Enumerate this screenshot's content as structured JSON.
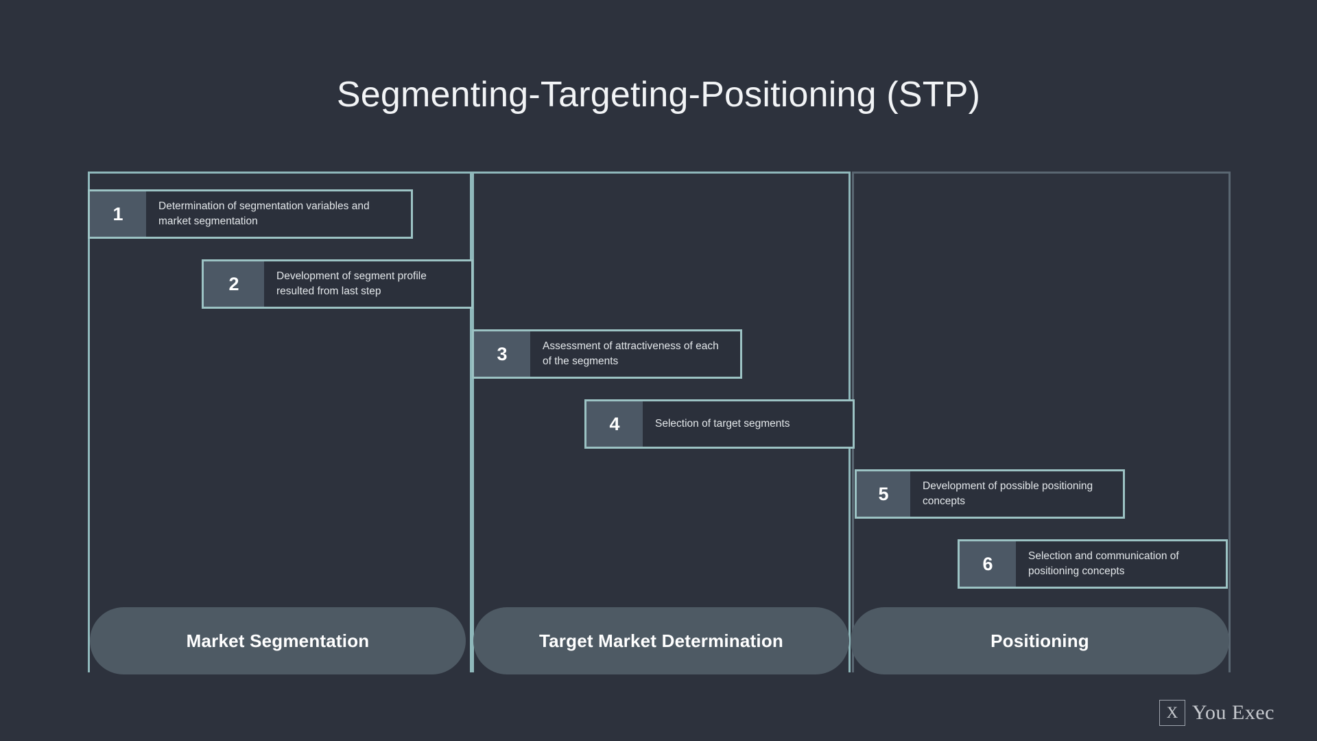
{
  "slide": {
    "title": "Segmenting-Targeting-Positioning (STP)",
    "background_color": "#2d323d"
  },
  "colors": {
    "background": "#2d323d",
    "step_border": "#9cc3c4",
    "step_number_bg": "#4c5865",
    "step_body_bg": "#2b303b",
    "column_border_active": "#8fb8bb",
    "column_border_muted": "#5a6772",
    "pill_bg": "#4e5a64",
    "text_primary": "#ffffff",
    "text_secondary": "#e3e7ea"
  },
  "columns": [
    {
      "id": "market-segmentation",
      "label": "Market Segmentation",
      "border_color": "#8fb8bb"
    },
    {
      "id": "target-market-determination",
      "label": "Target Market Determination",
      "border_color": "#8fb8bb"
    },
    {
      "id": "positioning",
      "label": "Positioning",
      "border_color": "#5a6772"
    }
  ],
  "steps": [
    {
      "number": "1",
      "text": "Determination of segmentation variables and market segmentation",
      "column": "market-segmentation"
    },
    {
      "number": "2",
      "text": "Development of segment profile resulted from last step",
      "column": "market-segmentation"
    },
    {
      "number": "3",
      "text": "Assessment of attractiveness of each of the segments",
      "column": "target-market-determination"
    },
    {
      "number": "4",
      "text": "Selection of target segments",
      "column": "target-market-determination"
    },
    {
      "number": "5",
      "text": "Development of possible positioning concepts",
      "column": "positioning"
    },
    {
      "number": "6",
      "text": "Selection and communication of positioning concepts",
      "column": "positioning"
    }
  ],
  "logo": {
    "mark": "X",
    "wordmark": "You Exec"
  }
}
